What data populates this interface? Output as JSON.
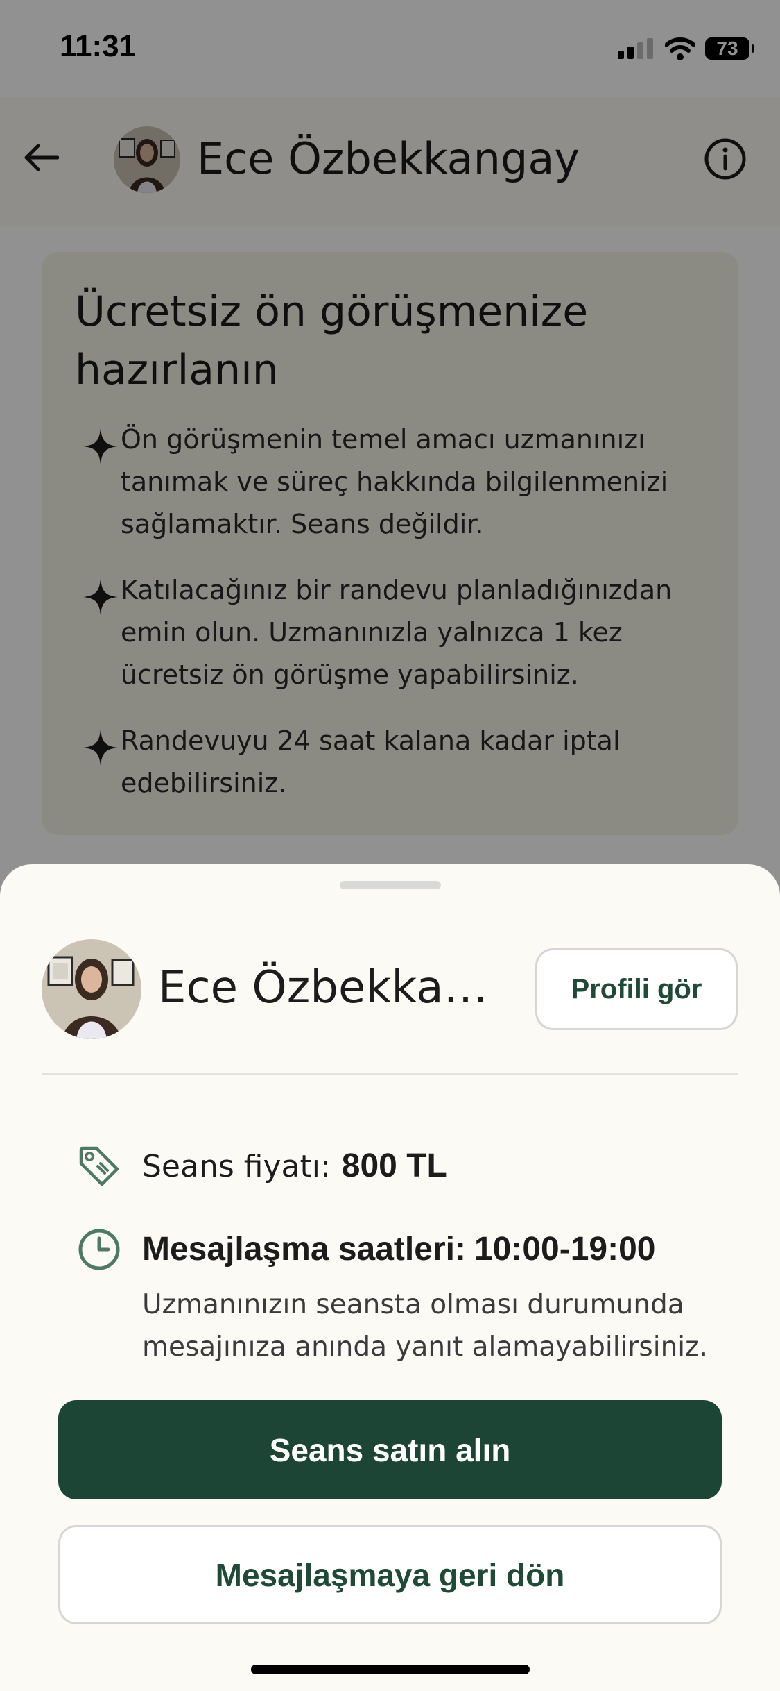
{
  "status_bar": {
    "time": "11:31",
    "battery": "73"
  },
  "header": {
    "title": "Ece Özbekkangay"
  },
  "prep_card": {
    "title": "Ücretsiz ön görüşmenize hazırlanın",
    "tips": [
      "Ön görüşmenin temel amacı uzmanınızı tanımak ve süreç hakkında bilgilenmenizi sağlamaktır. Seans değildir.",
      "Katılacağınız bir randevu planladığınızdan emin olun. Uzmanınızla yalnızca 1 kez ücretsiz ön görüşme yapabilirsiniz.",
      "Randevuyu 24 saat kalana kadar iptal edebilirsiniz."
    ]
  },
  "sheet": {
    "name": "Ece Özbekkangay",
    "profile_button": "Profili gör",
    "price_label": "Seans fiyatı:",
    "price_value": "800 TL",
    "hours_label": "Mesajlaşma saatleri:",
    "hours_value": "10:00-19:00",
    "hours_note": "Uzmanınızın seansta olması durumunda mesajınıza anında yanıt alamayabilirsiniz.",
    "primary_button": "Seans satın alın",
    "secondary_button": "Mesajlaşmaya geri dön"
  },
  "colors": {
    "primary": "#1c4535",
    "accent_text": "#1f4a37",
    "sheet_bg": "#fbfaf5",
    "card_bg": "#f7f4e6",
    "icon": "#4d7a66"
  },
  "icons": [
    "back-arrow-icon",
    "info-icon",
    "sparkle-icon",
    "price-tag-icon",
    "clock-icon",
    "wifi-icon",
    "signal-icon",
    "battery-icon"
  ]
}
